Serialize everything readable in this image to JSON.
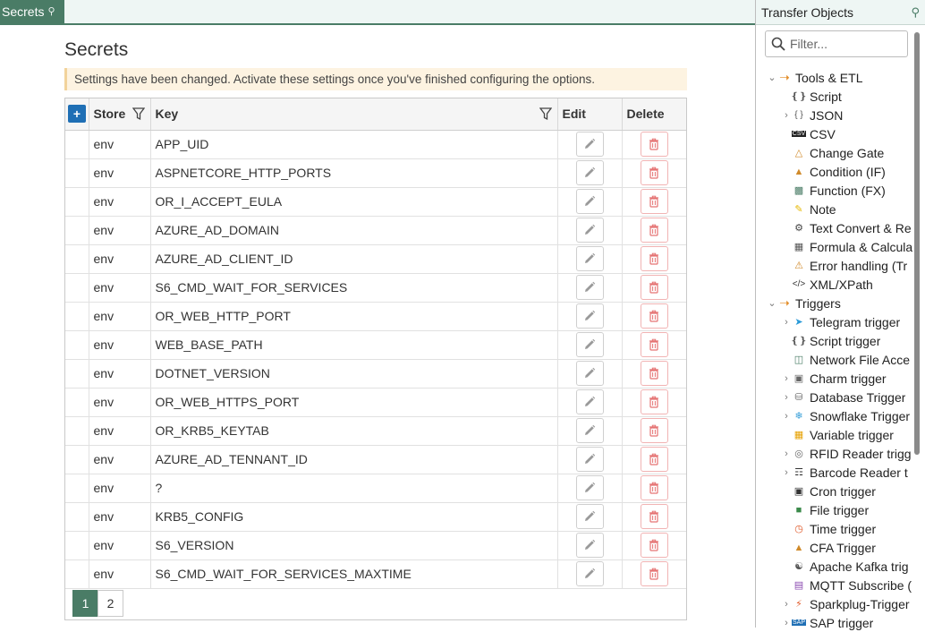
{
  "tab": {
    "label": "Secrets",
    "pin_icon": "pin-icon"
  },
  "page": {
    "title": "Secrets",
    "notice": "Settings have been changed. Activate these settings once you've finished configuring the options."
  },
  "grid": {
    "columns": {
      "store": "Store",
      "key": "Key",
      "edit": "Edit",
      "delete": "Delete"
    },
    "add_label": "+",
    "rows": [
      {
        "store": "env",
        "key": "APP_UID"
      },
      {
        "store": "env",
        "key": "ASPNETCORE_HTTP_PORTS"
      },
      {
        "store": "env",
        "key": "OR_I_ACCEPT_EULA"
      },
      {
        "store": "env",
        "key": "AZURE_AD_DOMAIN"
      },
      {
        "store": "env",
        "key": "AZURE_AD_CLIENT_ID"
      },
      {
        "store": "env",
        "key": "S6_CMD_WAIT_FOR_SERVICES"
      },
      {
        "store": "env",
        "key": "OR_WEB_HTTP_PORT"
      },
      {
        "store": "env",
        "key": "WEB_BASE_PATH"
      },
      {
        "store": "env",
        "key": "DOTNET_VERSION"
      },
      {
        "store": "env",
        "key": "OR_WEB_HTTPS_PORT"
      },
      {
        "store": "env",
        "key": "OR_KRB5_KEYTAB"
      },
      {
        "store": "env",
        "key": "AZURE_AD_TENNANT_ID"
      },
      {
        "store": "env",
        "key": "?"
      },
      {
        "store": "env",
        "key": "KRB5_CONFIG"
      },
      {
        "store": "env",
        "key": "S6_VERSION"
      },
      {
        "store": "env",
        "key": "S6_CMD_WAIT_FOR_SERVICES_MAXTIME"
      }
    ],
    "pages": [
      "1",
      "2"
    ],
    "active_page": "1"
  },
  "panel": {
    "title": "Transfer Objects",
    "filter_placeholder": "Filter...",
    "tree": [
      {
        "level": 0,
        "chev": "down",
        "icon": "arrow",
        "label": "Tools & ETL"
      },
      {
        "level": 1,
        "chev": "",
        "icon": "script",
        "label": "Script"
      },
      {
        "level": 1,
        "chev": "right",
        "icon": "json",
        "label": "JSON"
      },
      {
        "level": 1,
        "chev": "",
        "icon": "csv",
        "label": "CSV"
      },
      {
        "level": 1,
        "chev": "",
        "icon": "gate",
        "label": "Change Gate"
      },
      {
        "level": 1,
        "chev": "",
        "icon": "condition",
        "label": "Condition (IF)"
      },
      {
        "level": 1,
        "chev": "",
        "icon": "function",
        "label": "Function (FX)"
      },
      {
        "level": 1,
        "chev": "",
        "icon": "note",
        "label": "Note"
      },
      {
        "level": 1,
        "chev": "",
        "icon": "convert",
        "label": "Text Convert & Re"
      },
      {
        "level": 1,
        "chev": "",
        "icon": "formula",
        "label": "Formula & Calcula"
      },
      {
        "level": 1,
        "chev": "",
        "icon": "error",
        "label": "Error handling (Tr"
      },
      {
        "level": 1,
        "chev": "",
        "icon": "xml",
        "label": "XML/XPath"
      },
      {
        "level": 0,
        "chev": "down",
        "icon": "arrow",
        "label": "Triggers"
      },
      {
        "level": 1,
        "chev": "right",
        "icon": "telegram",
        "label": "Telegram trigger"
      },
      {
        "level": 1,
        "chev": "",
        "icon": "script",
        "label": "Script trigger"
      },
      {
        "level": 1,
        "chev": "",
        "icon": "network",
        "label": "Network File Acce"
      },
      {
        "level": 1,
        "chev": "right",
        "icon": "charm",
        "label": "Charm trigger"
      },
      {
        "level": 1,
        "chev": "right",
        "icon": "database",
        "label": "Database Trigger"
      },
      {
        "level": 1,
        "chev": "right",
        "icon": "snowflake",
        "label": "Snowflake Trigger"
      },
      {
        "level": 1,
        "chev": "",
        "icon": "variable",
        "label": "Variable trigger"
      },
      {
        "level": 1,
        "chev": "right",
        "icon": "rfid",
        "label": "RFID Reader trigg"
      },
      {
        "level": 1,
        "chev": "right",
        "icon": "barcode",
        "label": "Barcode Reader t"
      },
      {
        "level": 1,
        "chev": "",
        "icon": "cron",
        "label": "Cron trigger"
      },
      {
        "level": 1,
        "chev": "",
        "icon": "file",
        "label": "File trigger"
      },
      {
        "level": 1,
        "chev": "",
        "icon": "time",
        "label": "Time trigger"
      },
      {
        "level": 1,
        "chev": "",
        "icon": "cfa",
        "label": "CFA Trigger"
      },
      {
        "level": 1,
        "chev": "",
        "icon": "kafka",
        "label": "Apache Kafka trig"
      },
      {
        "level": 1,
        "chev": "",
        "icon": "mqtt",
        "label": "MQTT Subscribe ("
      },
      {
        "level": 1,
        "chev": "right",
        "icon": "sparkplug",
        "label": "Sparkplug-Trigger"
      },
      {
        "level": 1,
        "chev": "right",
        "icon": "sap",
        "label": "SAP trigger"
      }
    ]
  },
  "colors": {
    "accent": "#4a7c66",
    "add_button": "#1f6fb5",
    "notice_bg": "#fdf3e1",
    "delete_border": "#f1b3b3"
  }
}
